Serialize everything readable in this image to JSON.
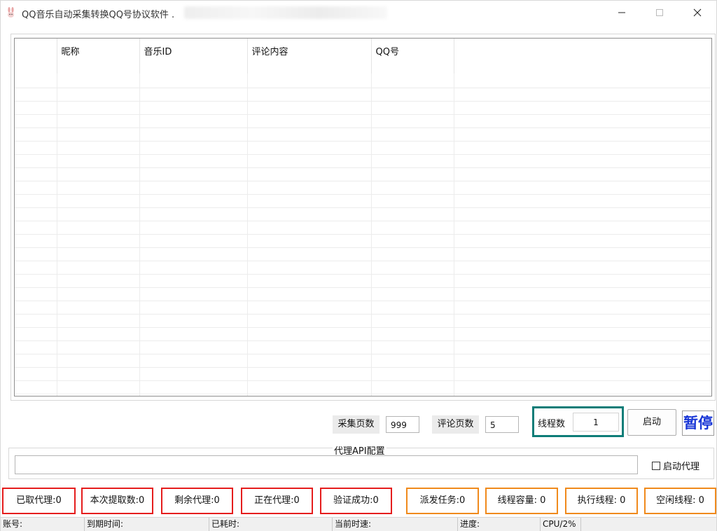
{
  "window": {
    "title": "QQ音乐自动采集转换QQ号协议软件 ."
  },
  "grid": {
    "columns": [
      "",
      "昵称",
      "音乐ID",
      "评论内容",
      "QQ号",
      ""
    ],
    "row_count": 26
  },
  "controls": {
    "pages_label": "采集页数",
    "pages_value": "999",
    "comment_pages_label": "评论页数",
    "comment_pages_value": "5",
    "threads_label": "线程数",
    "threads_value": "1",
    "start_button": "启动",
    "pause_button": "暂停"
  },
  "proxy": {
    "group_label": "代理API配置",
    "api_value": "",
    "enable_label": "启动代理",
    "enabled": false
  },
  "stats_red": [
    {
      "label": "已取代理:0"
    },
    {
      "label": "本次提取数:0"
    },
    {
      "label": "剩余代理:0"
    },
    {
      "label": "正在代理:0"
    },
    {
      "label": "验证成功:0"
    }
  ],
  "stats_orange": [
    {
      "label": "派发任务:0"
    },
    {
      "label": "线程容量: 0"
    },
    {
      "label": "执行线程: 0"
    },
    {
      "label": "空闲线程: 0"
    }
  ],
  "statusbar": {
    "account": "账号:",
    "expire": "到期时间:",
    "elapsed": "已耗时:",
    "speed": "当前时速:",
    "progress": "进度:",
    "cpu": "CPU/2%"
  },
  "colors": {
    "red_border": "#e51d1d",
    "orange_border": "#f08a1c",
    "threads_border": "#0e7d78",
    "pause_text": "#1836d6"
  },
  "icons": {
    "app": "rabbit-icon",
    "minimize": "minimize-icon",
    "maximize": "maximize-icon",
    "close": "close-icon"
  }
}
